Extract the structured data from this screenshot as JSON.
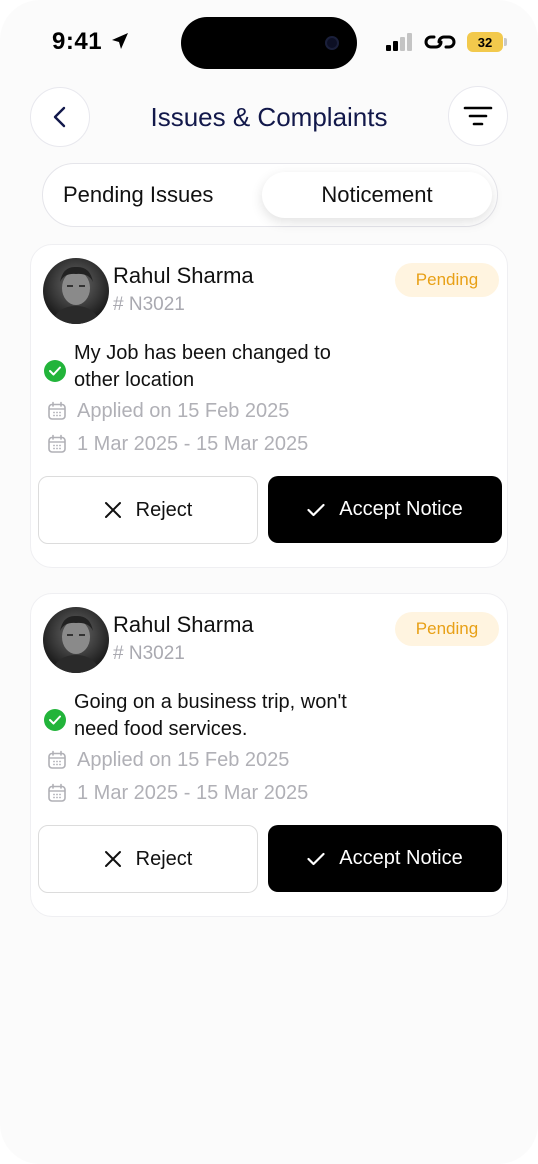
{
  "status_bar": {
    "time": "9:41",
    "battery": "32"
  },
  "header": {
    "title": "Issues & Complaints"
  },
  "segment": {
    "left_label": "Pending Issues",
    "right_label": "Noticement",
    "selected": "Noticement"
  },
  "cards": [
    {
      "name": "Rahul Sharma",
      "code": "# N3021",
      "status": "Pending",
      "description": "My Job has been changed to other location",
      "applied": "Applied on 15 Feb 2025",
      "range": "1 Mar 2025 - 15 Mar 2025",
      "reject_label": "Reject",
      "accept_label": "Accept Notice"
    },
    {
      "name": "Rahul Sharma",
      "code": "# N3021",
      "status": "Pending",
      "description": "Going on a business trip, won't need food services.",
      "applied": "Applied on 15 Feb 2025",
      "range": "1 Mar 2025 - 15 Mar 2025",
      "reject_label": "Reject",
      "accept_label": "Accept Notice"
    }
  ],
  "colors": {
    "title": "#12184a",
    "pending_text": "#e8a016",
    "pending_bg": "#fff4e0",
    "check": "#22b43a",
    "accept_bg": "#000000",
    "battery": "#f2c94c"
  }
}
